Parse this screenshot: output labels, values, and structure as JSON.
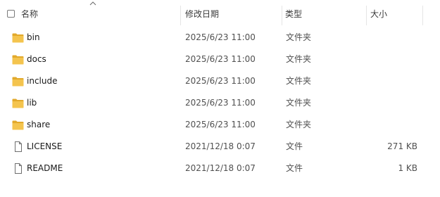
{
  "columns": {
    "name": "名称",
    "date": "修改日期",
    "type": "类型",
    "size": "大小"
  },
  "rows": [
    {
      "name": "bin",
      "date": "2025/6/23 11:00",
      "type": "文件夹",
      "size": "",
      "icon": "folder-icon"
    },
    {
      "name": "docs",
      "date": "2025/6/23 11:00",
      "type": "文件夹",
      "size": "",
      "icon": "folder-icon"
    },
    {
      "name": "include",
      "date": "2025/6/23 11:00",
      "type": "文件夹",
      "size": "",
      "icon": "folder-icon"
    },
    {
      "name": "lib",
      "date": "2025/6/23 11:00",
      "type": "文件夹",
      "size": "",
      "icon": "folder-icon"
    },
    {
      "name": "share",
      "date": "2025/6/23 11:00",
      "type": "文件夹",
      "size": "",
      "icon": "folder-icon"
    },
    {
      "name": "LICENSE",
      "date": "2021/12/18 0:07",
      "type": "文件",
      "size": "271 KB",
      "icon": "file-icon"
    },
    {
      "name": "README",
      "date": "2021/12/18 0:07",
      "type": "文件",
      "size": "1 KB",
      "icon": "file-icon"
    }
  ],
  "colors": {
    "folder": "#F4C44E",
    "folder_dark": "#E2A92B",
    "file_outline": "#6e6e6e"
  }
}
